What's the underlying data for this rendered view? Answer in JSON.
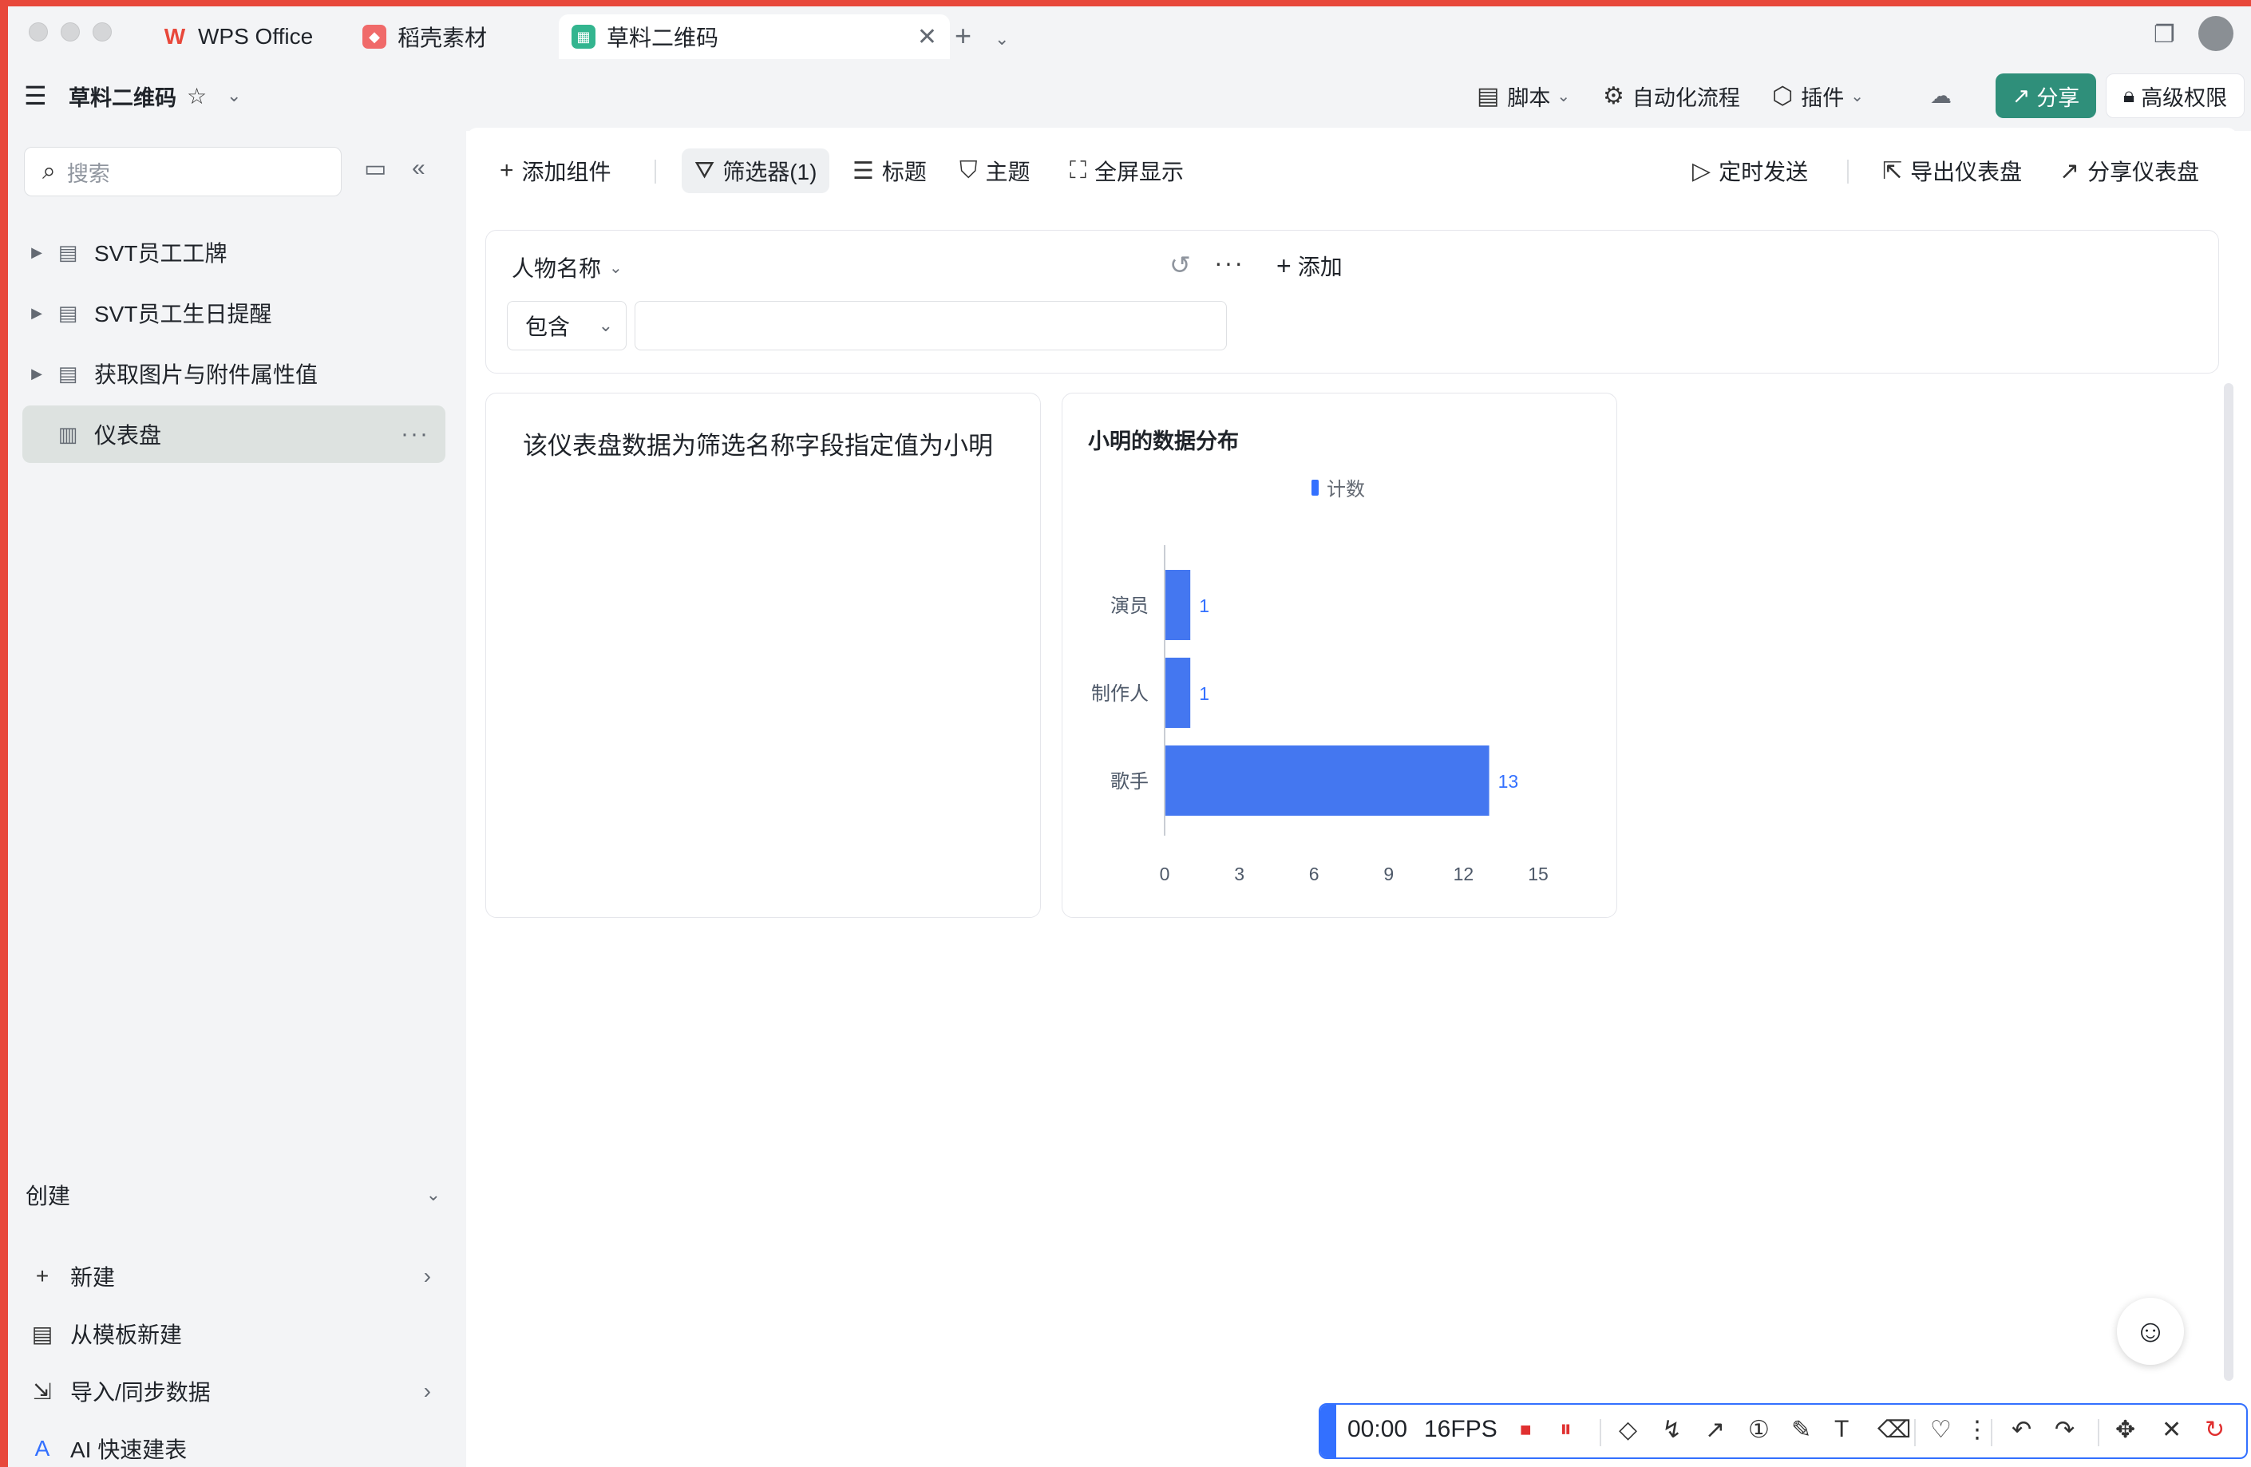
{
  "window": {
    "tabs": [
      {
        "label": "WPS Office"
      },
      {
        "label": "稻壳素材"
      },
      {
        "label": "草料二维码"
      }
    ]
  },
  "header": {
    "doc_title": "草料二维码",
    "script": "脚本",
    "automation": "自动化流程",
    "plugin": "插件",
    "share": "分享",
    "permission": "高级权限"
  },
  "sidebar": {
    "search_placeholder": "搜索",
    "items": [
      {
        "label": "SVT员工工牌"
      },
      {
        "label": "SVT员工生日提醒"
      },
      {
        "label": "获取图片与附件属性值"
      },
      {
        "label": "仪表盘"
      }
    ],
    "create_label": "创建",
    "create_items": [
      {
        "label": "新建"
      },
      {
        "label": "从模板新建"
      },
      {
        "label": "导入/同步数据"
      },
      {
        "label": "AI 快速建表"
      }
    ]
  },
  "toolbar": {
    "add_widget": "添加组件",
    "filter": "筛选器(1)",
    "title": "标题",
    "theme": "主题",
    "fullscreen": "全屏显示",
    "schedule_send": "定时发送",
    "export_dashboard": "导出仪表盘",
    "share_dashboard": "分享仪表盘"
  },
  "filter": {
    "field": "人物名称",
    "operator": "包含",
    "value": "",
    "add": "添加"
  },
  "text_card": {
    "content": "该仪表盘数据为筛选名称字段指定值为小明"
  },
  "chart_data": {
    "type": "bar",
    "orientation": "horizontal",
    "title": "小明的数据分布",
    "categories": [
      "演员",
      "制作人",
      "歌手"
    ],
    "series": [
      {
        "name": "计数",
        "values": [
          1,
          1,
          13
        ],
        "color": "#4477f0"
      }
    ],
    "xlim": [
      0,
      15
    ],
    "xticks": [
      0,
      3,
      6,
      9,
      12,
      15
    ],
    "legend": "top"
  },
  "recorder": {
    "time": "00:00",
    "fps": "16FPS"
  },
  "colors": {
    "accent_green": "#2f8f7a",
    "bar_blue": "#4477f0",
    "frame_red": "#e8483b",
    "recorder_blue": "#3370ff"
  }
}
